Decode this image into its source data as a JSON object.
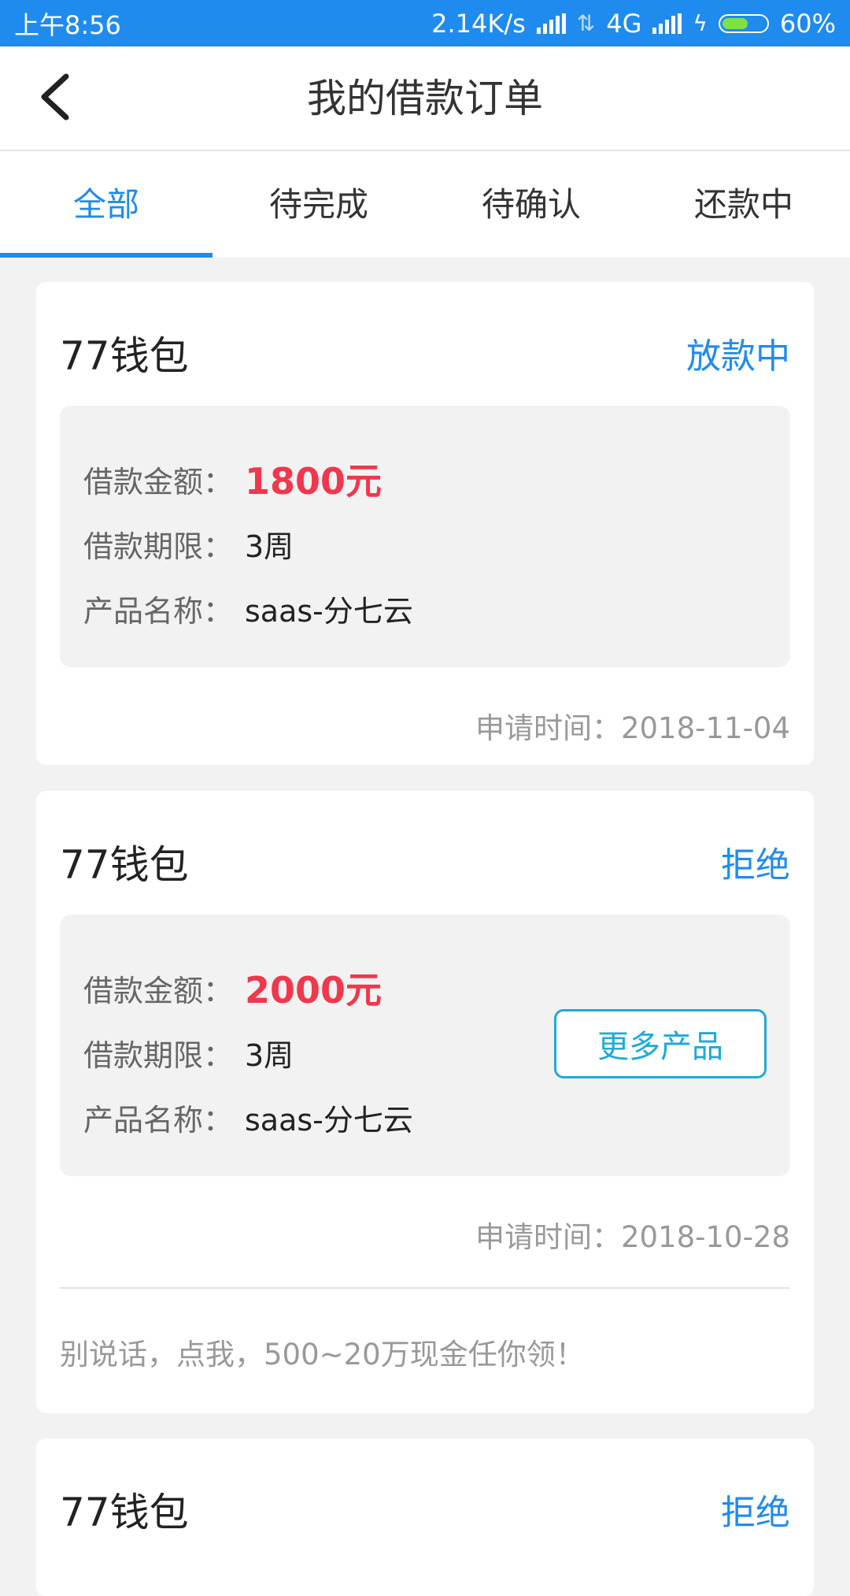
{
  "status_bar": {
    "time": "上午8:56",
    "speed": "2.14K/s",
    "network": "4G",
    "battery": "60%",
    "battery_level": 0.6
  },
  "header": {
    "title": "我的借款订单",
    "back_icon": "chevron-left-icon"
  },
  "tabs": [
    {
      "label": "全部",
      "active": true
    },
    {
      "label": "待完成",
      "active": false
    },
    {
      "label": "待确认",
      "active": false
    },
    {
      "label": "还款中",
      "active": false
    }
  ],
  "labels": {
    "amount": "借款金额：",
    "term": "借款期限：",
    "product": "产品名称：",
    "apply_time": "申请时间："
  },
  "orders": [
    {
      "merchant": "77钱包",
      "status": "放款中",
      "amount": "1800元",
      "term": "3周",
      "product": "saas-分七云",
      "apply_date": "2018-11-04"
    },
    {
      "merchant": "77钱包",
      "status": "拒绝",
      "amount": "2000元",
      "term": "3周",
      "product": "saas-分七云",
      "apply_date": "2018-10-28",
      "more_button": "更多产品",
      "promo": "别说话，点我，500~20万现金任你领！"
    },
    {
      "merchant": "77钱包",
      "status": "拒绝"
    }
  ],
  "colors": {
    "accent": "#1f8bef",
    "amount": "#f0374c",
    "button_border": "#1eaad9"
  }
}
